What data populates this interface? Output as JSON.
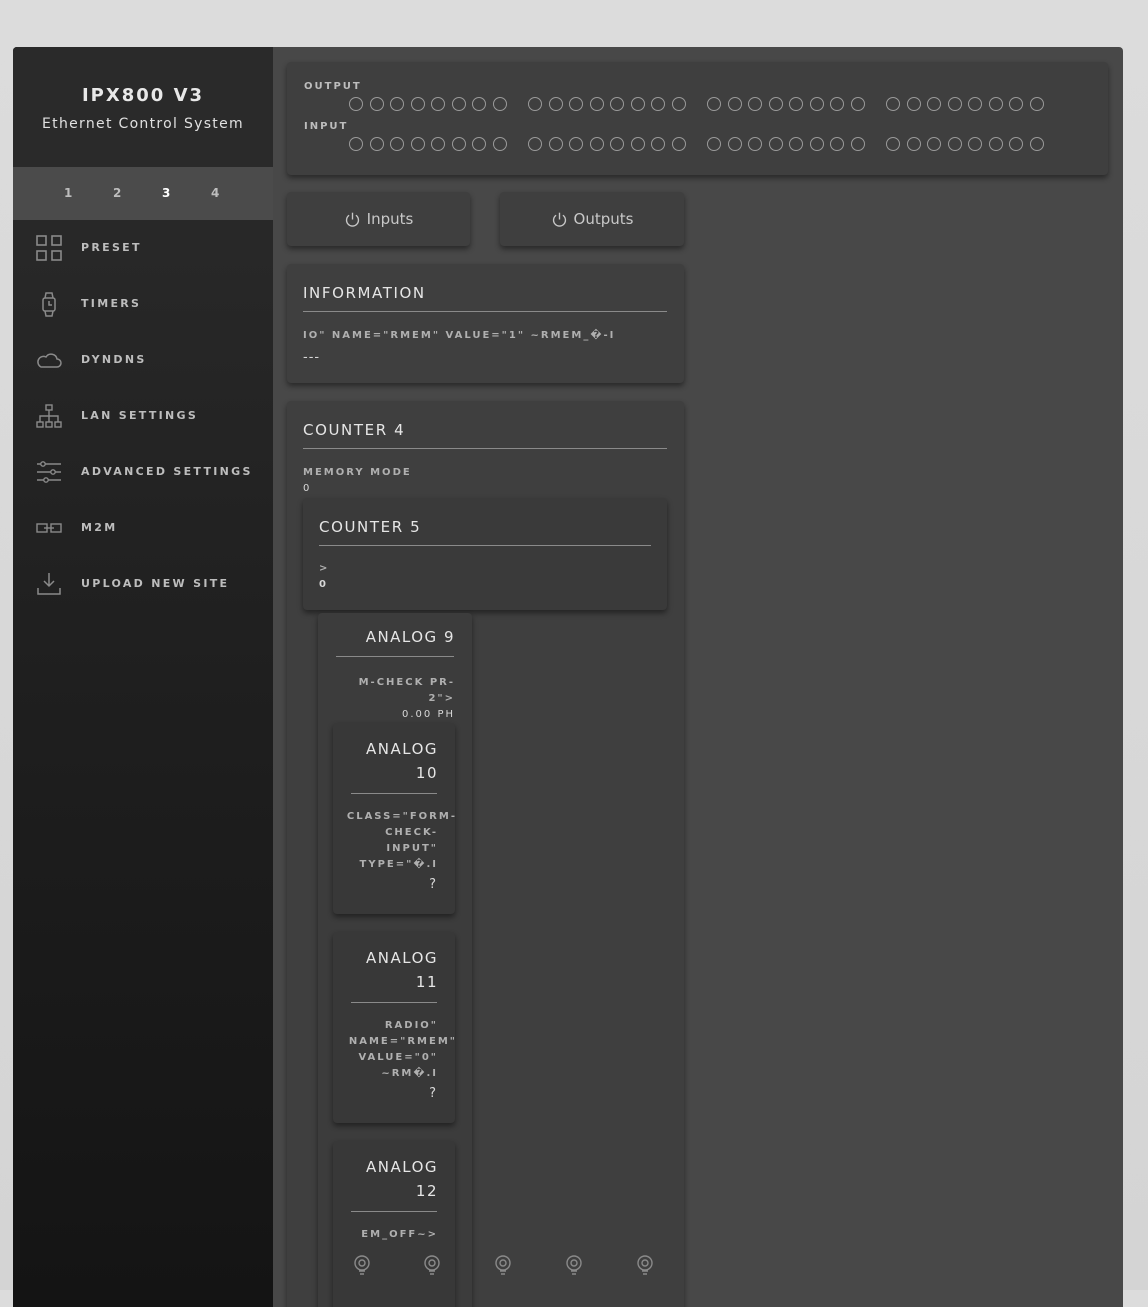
{
  "brand": {
    "title": "IPX800 V3",
    "subtitle": "Ethernet Control System"
  },
  "pages": [
    "1",
    "2",
    "3",
    "4"
  ],
  "active_page": "3",
  "nav": [
    {
      "label": "PRESET",
      "icon": "grid-icon"
    },
    {
      "label": "TIMERS",
      "icon": "watch-icon"
    },
    {
      "label": "DYNDNS",
      "icon": "cloud-icon"
    },
    {
      "label": "LAN SETTINGS",
      "icon": "network-icon"
    },
    {
      "label": "ADVANCED SETTINGS",
      "icon": "sliders-icon"
    },
    {
      "label": "M2M",
      "icon": "link-icon"
    },
    {
      "label": "UPLOAD NEW SITE",
      "icon": "download-icon"
    }
  ],
  "io": {
    "output_label": "OUTPUT",
    "input_label": "INPUT",
    "groups": 4,
    "leds_per_group": 8
  },
  "buttons": {
    "inputs_label": "Inputs",
    "outputs_label": "Outputs"
  },
  "information": {
    "title": "INFORMATION",
    "text": "IO\" NAME=\"RMEM\" VALUE=\"1\" ~RMEM_�-I",
    "value": "---"
  },
  "counter4": {
    "title": "COUNTER 4",
    "label": "MEMORY MODE",
    "value": "0"
  },
  "counter5": {
    "title": "COUNTER 5",
    "label": ">",
    "value": "0"
  },
  "analog9": {
    "title": "ANALOG 9",
    "line1": "M-CHECK PR-",
    "line2": "2\">",
    "value": "0.00 PH"
  },
  "analog10": {
    "title1": "ANALOG",
    "title2": "10",
    "line1": "CLASS=\"FORM-",
    "line2": "CHECK-",
    "line3": "INPUT\"",
    "line4": "TYPE=\"�.I",
    "value": "?"
  },
  "analog11": {
    "title1": "ANALOG",
    "title2": "11",
    "line1": "RADIO\"",
    "line2": "NAME=\"RMEM\"",
    "line3": "VALUE=\"0\"",
    "line4": "~RM�.I",
    "value": "?"
  },
  "analog12": {
    "title1": "ANALOG",
    "title2": "12",
    "line1": "EM_OFF~>"
  },
  "bulbs": [
    "bulb-icon",
    "bulb-icon",
    "bulb-icon",
    "bulb-icon",
    "bulb-icon"
  ]
}
